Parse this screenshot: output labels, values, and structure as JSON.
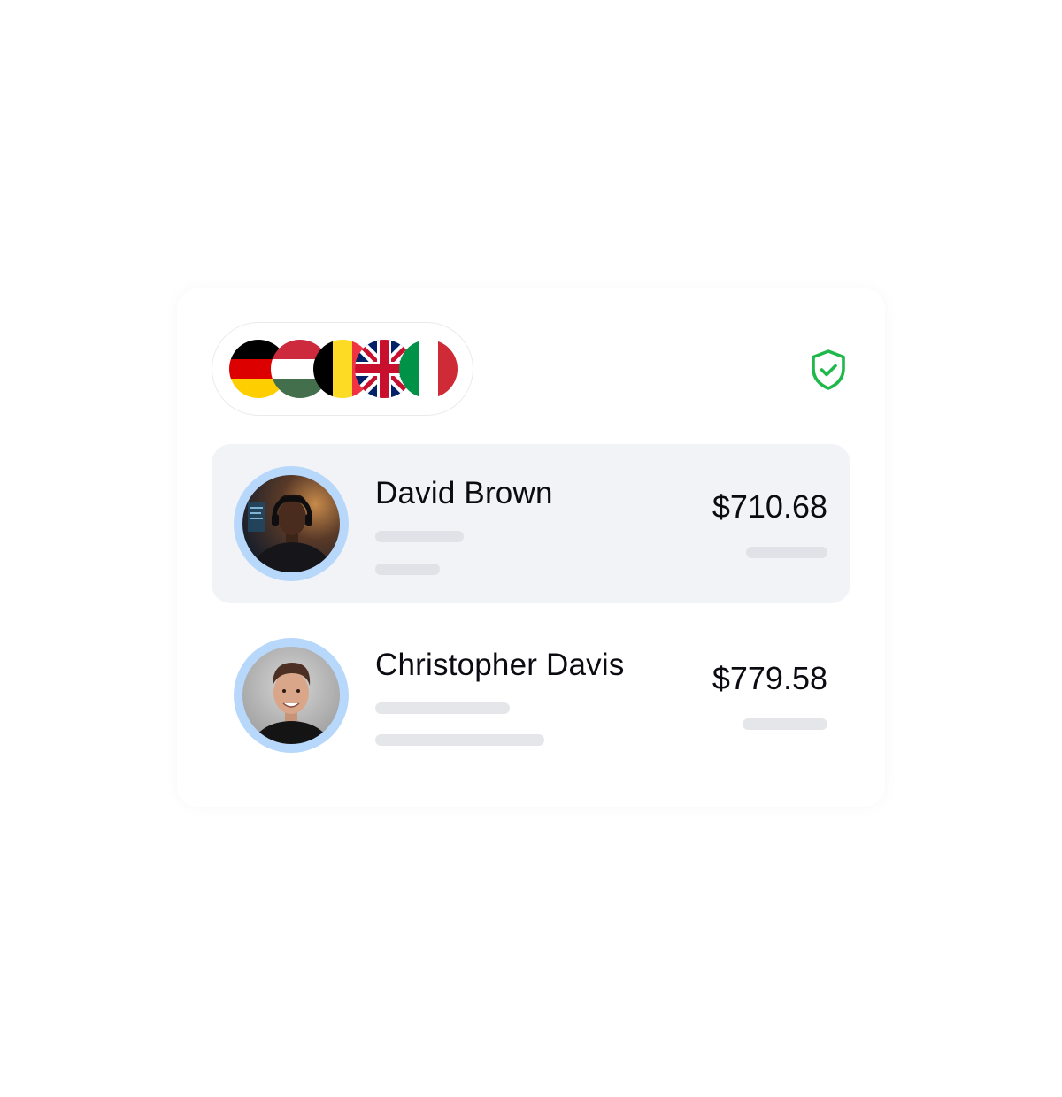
{
  "flags": [
    {
      "country": "Germany",
      "icon": "germany-flag-icon"
    },
    {
      "country": "Hungary",
      "icon": "hungary-flag-icon"
    },
    {
      "country": "Belgium",
      "icon": "belgium-flag-icon"
    },
    {
      "country": "United Kingdom",
      "icon": "uk-flag-icon"
    },
    {
      "country": "Italy",
      "icon": "italy-flag-icon"
    }
  ],
  "status": {
    "icon": "shield-check-icon",
    "color": "#1fb84a"
  },
  "accent": {
    "avatar_ring": "#b7d8fb",
    "active_row": "#f2f3f7",
    "placeholder": "#e5e6ea"
  },
  "rows": [
    {
      "name": "David Brown",
      "amount": "$710.68",
      "avatar_icon": "avatar-david-brown",
      "selected": true
    },
    {
      "name": "Christopher Davis",
      "amount": "$779.58",
      "avatar_icon": "avatar-christopher-davis",
      "selected": false
    }
  ]
}
